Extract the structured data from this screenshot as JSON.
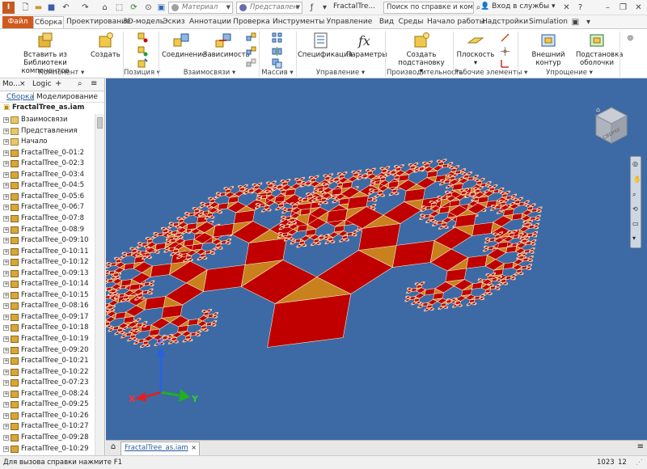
{
  "titlebar": {
    "doc_title": "FractalTre...",
    "search_placeholder": "Поиск по справке и командам...",
    "signin": "Вход в службы",
    "material": "Материал",
    "representation": "Представлен",
    "material_color": "#a0a0a0",
    "representation_color": "#6a6ab0"
  },
  "tabs": [
    {
      "label": "Файл"
    },
    {
      "label": "Сборка"
    },
    {
      "label": "Проектирование"
    },
    {
      "label": "3D-модель"
    },
    {
      "label": "Эскиз"
    },
    {
      "label": "Аннотации"
    },
    {
      "label": "Проверка"
    },
    {
      "label": "Инструменты"
    },
    {
      "label": "Управление"
    },
    {
      "label": "Вид"
    },
    {
      "label": "Среды"
    },
    {
      "label": "Начало работы"
    },
    {
      "label": "Надстройки"
    },
    {
      "label": "Simulation"
    }
  ],
  "ribbon": {
    "component": {
      "label": "Компонент",
      "insert": "Вставить из Библиотеки компонентов",
      "create": "Создать"
    },
    "position": {
      "label": "Позиция"
    },
    "constraints": {
      "label": "Взаимосвязи",
      "joint": "Соединение",
      "constrain": "Зависимость"
    },
    "pattern": {
      "label": "Массив"
    },
    "manage": {
      "label": "Управление",
      "bom": "Спецификация",
      "params": "Параметры"
    },
    "productivity": {
      "label": "Производительность",
      "substitute": "Создать подстановку"
    },
    "work_features": {
      "label": "Рабочие элементы",
      "plane": "Плоскость"
    },
    "simplification": {
      "label": "Упрощение",
      "shrinkwrap": "Внешний контур",
      "substitute": "Подстановка оболочки"
    }
  },
  "browser": {
    "tab_model": "Мо...",
    "tab_logic": "Logic",
    "sub_assembly": "Сборка",
    "sub_modeling": "Моделирование",
    "root": "FractalTree_as.iam",
    "items": [
      {
        "label": "Взаимосвязи",
        "type": "folder"
      },
      {
        "label": "Представления",
        "type": "folder"
      },
      {
        "label": "Начало",
        "type": "folder"
      },
      {
        "label": "FractalTree_0-01:2",
        "type": "part"
      },
      {
        "label": "FractalTree_0-02:3",
        "type": "part"
      },
      {
        "label": "FractalTree_0-03:4",
        "type": "part"
      },
      {
        "label": "FractalTree_0-04:5",
        "type": "part"
      },
      {
        "label": "FractalTree_0-05:6",
        "type": "part"
      },
      {
        "label": "FractalTree_0-06:7",
        "type": "part"
      },
      {
        "label": "FractalTree_0-07:8",
        "type": "part"
      },
      {
        "label": "FractalTree_0-08:9",
        "type": "part"
      },
      {
        "label": "FractalTree_0-09:10",
        "type": "part"
      },
      {
        "label": "FractalTree_0-10:11",
        "type": "part"
      },
      {
        "label": "FractalTree_0-10:12",
        "type": "part"
      },
      {
        "label": "FractalTree_0-09:13",
        "type": "part"
      },
      {
        "label": "FractalTree_0-10:14",
        "type": "part"
      },
      {
        "label": "FractalTree_0-10:15",
        "type": "part"
      },
      {
        "label": "FractalTree_0-08:16",
        "type": "part"
      },
      {
        "label": "FractalTree_0-09:17",
        "type": "part"
      },
      {
        "label": "FractalTree_0-10:18",
        "type": "part"
      },
      {
        "label": "FractalTree_0-10:19",
        "type": "part"
      },
      {
        "label": "FractalTree_0-09:20",
        "type": "part"
      },
      {
        "label": "FractalTree_0-10:21",
        "type": "part"
      },
      {
        "label": "FractalTree_0-10:22",
        "type": "part"
      },
      {
        "label": "FractalTree_0-07:23",
        "type": "part"
      },
      {
        "label": "FractalTree_0-08:24",
        "type": "part"
      },
      {
        "label": "FractalTree_0-09:25",
        "type": "part"
      },
      {
        "label": "FractalTree_0-10:26",
        "type": "part"
      },
      {
        "label": "FractalTree_0-10:27",
        "type": "part"
      },
      {
        "label": "FractalTree_0-09:28",
        "type": "part"
      },
      {
        "label": "FractalTree_0-10:29",
        "type": "part"
      }
    ]
  },
  "viewport": {
    "background": "#3d6aa4",
    "square_color": "#c00000",
    "triangle_color": "#c8811c",
    "edge_color": "#f2e6cc",
    "viewcube_label": "СВЕРХУ",
    "axis_x": "X",
    "axis_y": "Y",
    "axis_z": "Z"
  },
  "doc_tabs": [
    {
      "label": "FractalTree_as.iam"
    }
  ],
  "status": {
    "help": "Для вызова справки нажмите F1",
    "count1": "1023",
    "count2": "12"
  }
}
